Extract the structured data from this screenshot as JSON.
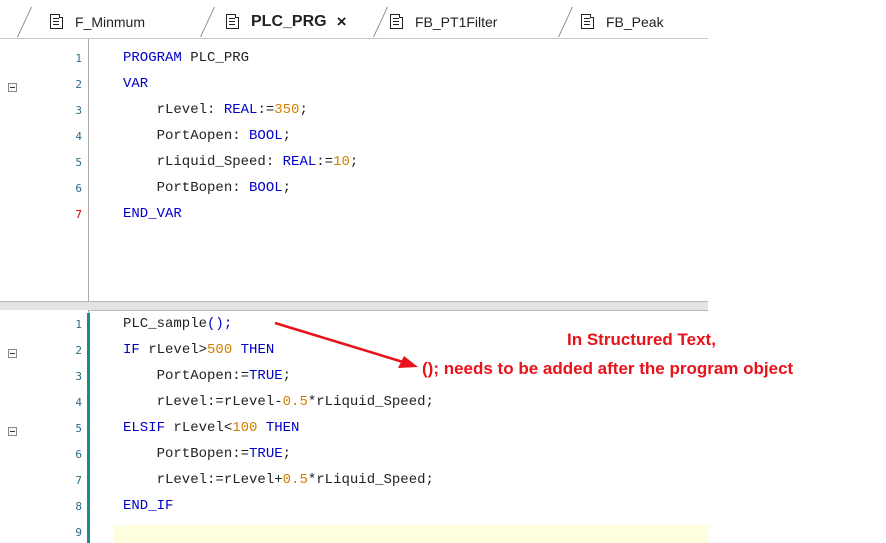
{
  "tabs": [
    {
      "label": "F_Minmum",
      "active": false
    },
    {
      "label": "PLC_PRG",
      "active": true,
      "close_label": "×"
    },
    {
      "label": "FB_PT1Filter",
      "active": false
    },
    {
      "label": "FB_Peak",
      "active": false
    }
  ],
  "declaration": {
    "line_numbers": [
      "1",
      "2",
      "3",
      "4",
      "5",
      "6",
      "7"
    ],
    "line1": {
      "kw": "PROGRAM",
      "rest": " PLC_PRG"
    },
    "line2": {
      "kw": "VAR"
    },
    "line3": {
      "id": "    rLevel: ",
      "type": "REAL",
      "op": ":=",
      "num": "350",
      "end": ";"
    },
    "line4": {
      "id": "    PortAopen: ",
      "type": "BOOL",
      "end": ";"
    },
    "line5": {
      "id": "    rLiquid_Speed: ",
      "type": "REAL",
      "op": ":=",
      "num": "10",
      "end": ";"
    },
    "line6": {
      "id": "    PortBopen: ",
      "type": "BOOL",
      "end": ";"
    },
    "line7": {
      "kw": "END_VAR"
    }
  },
  "implementation": {
    "line_numbers": [
      "1",
      "2",
      "3",
      "4",
      "5",
      "6",
      "7",
      "8",
      "9"
    ],
    "line1": {
      "text": "PLC_sample",
      "punct": "();"
    },
    "line2": {
      "kw1": "IF",
      "mid": " rLevel",
      "op": ">",
      "num": "500",
      "kw2": " THEN"
    },
    "line3": {
      "id": "    PortAopen",
      "op": ":=",
      "kw": "TRUE",
      "end": ";"
    },
    "line4": {
      "id": "    rLevel",
      "op1": ":=",
      "id2": "rLevel",
      "op2": "-",
      "num": "0.5",
      "op3": "*",
      "id3": "rLiquid_Speed",
      "end": ";"
    },
    "line5": {
      "kw1": "ELSIF",
      "mid": " rLevel",
      "op": "<",
      "num": "100",
      "kw2": " THEN"
    },
    "line6": {
      "id": "    PortBopen",
      "op": ":=",
      "kw": "TRUE",
      "end": ";"
    },
    "line7": {
      "id": "    rLevel",
      "op1": ":=",
      "id2": "rLevel",
      "op2": "+",
      "num": "0.5",
      "op3": "*",
      "id3": "rLiquid_Speed",
      "end": ";"
    },
    "line8": {
      "kw": "END_IF"
    }
  },
  "annotation": {
    "title": "In Structured Text,",
    "body": "(); needs to be added after the program object",
    "color": "#e8121b"
  },
  "colors": {
    "keyword": "#0000c8",
    "number": "#d08000",
    "gutter_bar": "#1f8a8a",
    "line_number": "#2b6a8a"
  }
}
